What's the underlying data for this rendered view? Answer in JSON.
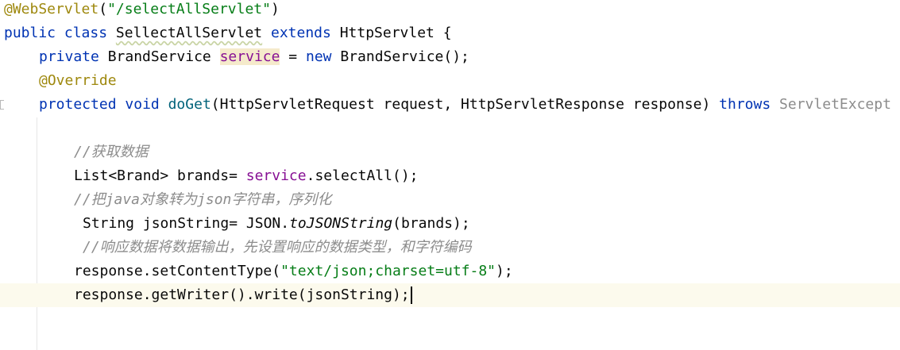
{
  "code": {
    "l1": {
      "annotation": "@WebServlet",
      "open_paren": "(",
      "path_string": "\"/selectAllServlet\"",
      "close_paren": ")"
    },
    "l2": {
      "kw_public": "public",
      "kw_class": "class",
      "class_name": "SellectAllServlet",
      "kw_extends": "extends",
      "rest": "HttpServlet {"
    },
    "l3": {
      "kw_private": "private",
      "type": "BrandService",
      "field": "service",
      "assign": "=",
      "kw_new": "new",
      "ctor": "BrandService();"
    },
    "l4": {
      "annotation": "@Override"
    },
    "l5": {
      "kw_protected": "protected",
      "kw_void": "void",
      "method_name": "doGet",
      "params": "(HttpServletRequest request, HttpServletResponse response)",
      "kw_throws": "throws",
      "exception": "ServletExcept"
    },
    "l7": {
      "comment": "//获取数据"
    },
    "l8": {
      "prefix": "List<Brand> brands=",
      "field": "service",
      "suffix": ".selectAll();"
    },
    "l9": {
      "comment": "//把java对象转为json字符串，序列化"
    },
    "l10": {
      "prefix": "String jsonString= JSON.",
      "static_method": "toJSONString",
      "suffix": "(brands);"
    },
    "l11": {
      "comment": "//响应数据将数据输出，先设置响应的数据类型，和字符编码"
    },
    "l12": {
      "prefix": "response.setContentType(",
      "string": "\"text/json;charset=utf-8\"",
      "suffix": ");"
    },
    "l13": {
      "code": "response.getWriter().write(jsonString);"
    }
  },
  "colors": {
    "keyword": "#0033b3",
    "annotation": "#9e880d",
    "string": "#067d17",
    "field": "#871094",
    "comment": "#8c8c8c",
    "method_declaration": "#00627a",
    "caret_line": "#fcfaed"
  }
}
